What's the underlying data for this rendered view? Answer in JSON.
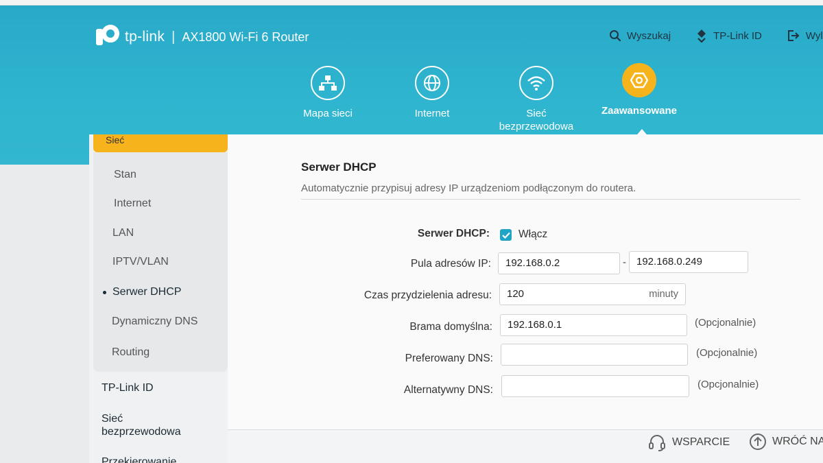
{
  "header": {
    "brand": "tp-link",
    "separator": "|",
    "model": "AX1800 Wi-Fi 6 Router",
    "links": [
      {
        "label": "Wyszukaj",
        "icon": "search-icon"
      },
      {
        "label": "TP-Link ID",
        "icon": "tplink-id-icon"
      },
      {
        "label": "Wyl",
        "icon": "logout-icon"
      }
    ]
  },
  "nav": {
    "items": [
      {
        "label": "Mapa sieci",
        "icon": "network-map-icon",
        "active": false
      },
      {
        "label": "Internet",
        "icon": "globe-icon",
        "active": false
      },
      {
        "label_line1": "Sieć",
        "label_line2": "bezprzewodowa",
        "icon": "wifi-icon",
        "active": false
      },
      {
        "label": "Zaawansowane",
        "icon": "gear-icon",
        "active": true
      }
    ],
    "accent_color": "#f6b31b"
  },
  "sidebar": {
    "top_label": "Sieć",
    "sub_items": [
      {
        "label": "Stan"
      },
      {
        "label": "Internet"
      },
      {
        "label": "LAN"
      },
      {
        "label": "IPTV/VLAN"
      },
      {
        "label": "Serwer DHCP",
        "active": true
      },
      {
        "label": "Dynamiczny DNS"
      },
      {
        "label": "Routing"
      }
    ],
    "main_items": [
      {
        "label": "TP-Link ID"
      },
      {
        "label_line1": "Sieć",
        "label_line2": "bezprzewodowa"
      },
      {
        "label": "Przekierowanie"
      }
    ]
  },
  "main": {
    "title": "Serwer DHCP",
    "description": "Automatycznie przypisuj adresy IP urządzeniom podłączonym do routera.",
    "form": {
      "dhcp_server": {
        "label": "Serwer DHCP:",
        "checked": true,
        "check_label": "Włącz"
      },
      "ip_pool": {
        "label": "Pula adresów IP:",
        "start": "192.168.0.2",
        "separator": "-",
        "end": "192.168.0.249"
      },
      "lease_time": {
        "label": "Czas przydzielenia adresu:",
        "value": "120",
        "suffix": "minuty"
      },
      "gateway": {
        "label": "Brama domyślna:",
        "value": "192.168.0.1",
        "note": "(Opcjonalnie)"
      },
      "preferred_dns": {
        "label": "Preferowany DNS:",
        "value": "",
        "note": "(Opcjonalnie)"
      },
      "alternate_dns": {
        "label": "Alternatywny DNS:",
        "value": "",
        "note": "(Opcjonalnie)"
      }
    }
  },
  "footer": {
    "support": "WSPARCIE",
    "back": "WRÓĆ NA"
  },
  "colors": {
    "header_bg": "#2fb5cf",
    "accent": "#f6b31b",
    "checkbox": "#1fa4c6"
  }
}
